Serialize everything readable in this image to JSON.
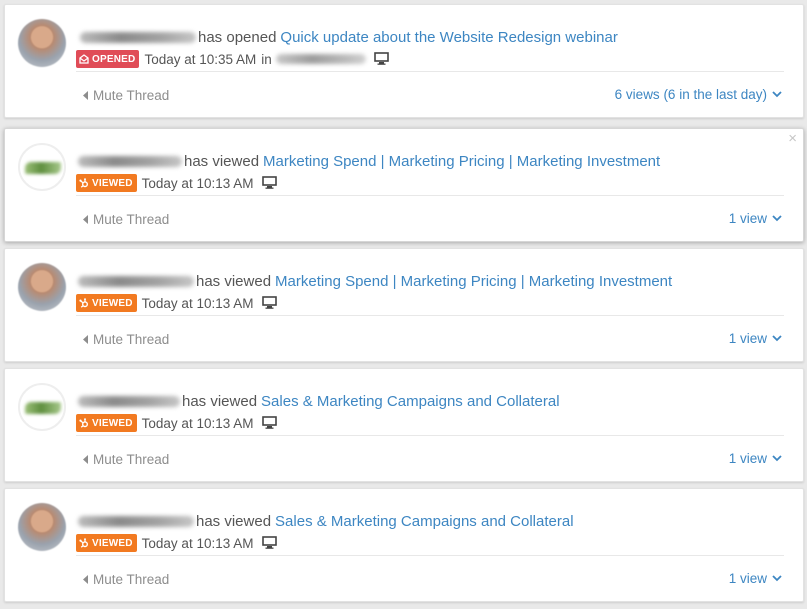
{
  "colors": {
    "link": "#3d86c2",
    "opened_badge": "#e04c57",
    "viewed_badge": "#f27a21",
    "muted_text": "#8d8d8d"
  },
  "feed": [
    {
      "avatar": "person",
      "action": "has opened",
      "title": "Quick update about the Website Redesign webinar",
      "badge": "OPENED",
      "badge_icon": "envelope-open-icon",
      "time": "Today at 10:35 AM",
      "location_prefix": "in",
      "device_icon": "monitor-icon",
      "mute": "Mute Thread",
      "views": "6 views (6 in the last day)",
      "close": ""
    },
    {
      "avatar": "logo",
      "action": "has viewed",
      "title": "Marketing Spend | Marketing Pricing | Marketing Investment",
      "badge": "VIEWED",
      "badge_icon": "hubspot-sprocket-icon",
      "time": "Today at 10:13 AM",
      "device_icon": "monitor-icon",
      "mute": "Mute Thread",
      "views": "1 view",
      "close": "×"
    },
    {
      "avatar": "person",
      "action": "has viewed",
      "title": "Marketing Spend | Marketing Pricing | Marketing Investment",
      "badge": "VIEWED",
      "badge_icon": "hubspot-sprocket-icon",
      "time": "Today at 10:13 AM",
      "device_icon": "monitor-icon",
      "mute": "Mute Thread",
      "views": "1 view",
      "close": ""
    },
    {
      "avatar": "logo",
      "action": "has viewed",
      "title": "Sales & Marketing Campaigns and Collateral",
      "badge": "VIEWED",
      "badge_icon": "hubspot-sprocket-icon",
      "time": "Today at 10:13 AM",
      "device_icon": "monitor-icon",
      "mute": "Mute Thread",
      "views": "1 view",
      "close": ""
    },
    {
      "avatar": "person",
      "action": "has viewed",
      "title": "Sales & Marketing Campaigns and Collateral",
      "badge": "VIEWED",
      "badge_icon": "hubspot-sprocket-icon",
      "time": "Today at 10:13 AM",
      "device_icon": "monitor-icon",
      "mute": "Mute Thread",
      "views": "1 view",
      "close": ""
    }
  ]
}
